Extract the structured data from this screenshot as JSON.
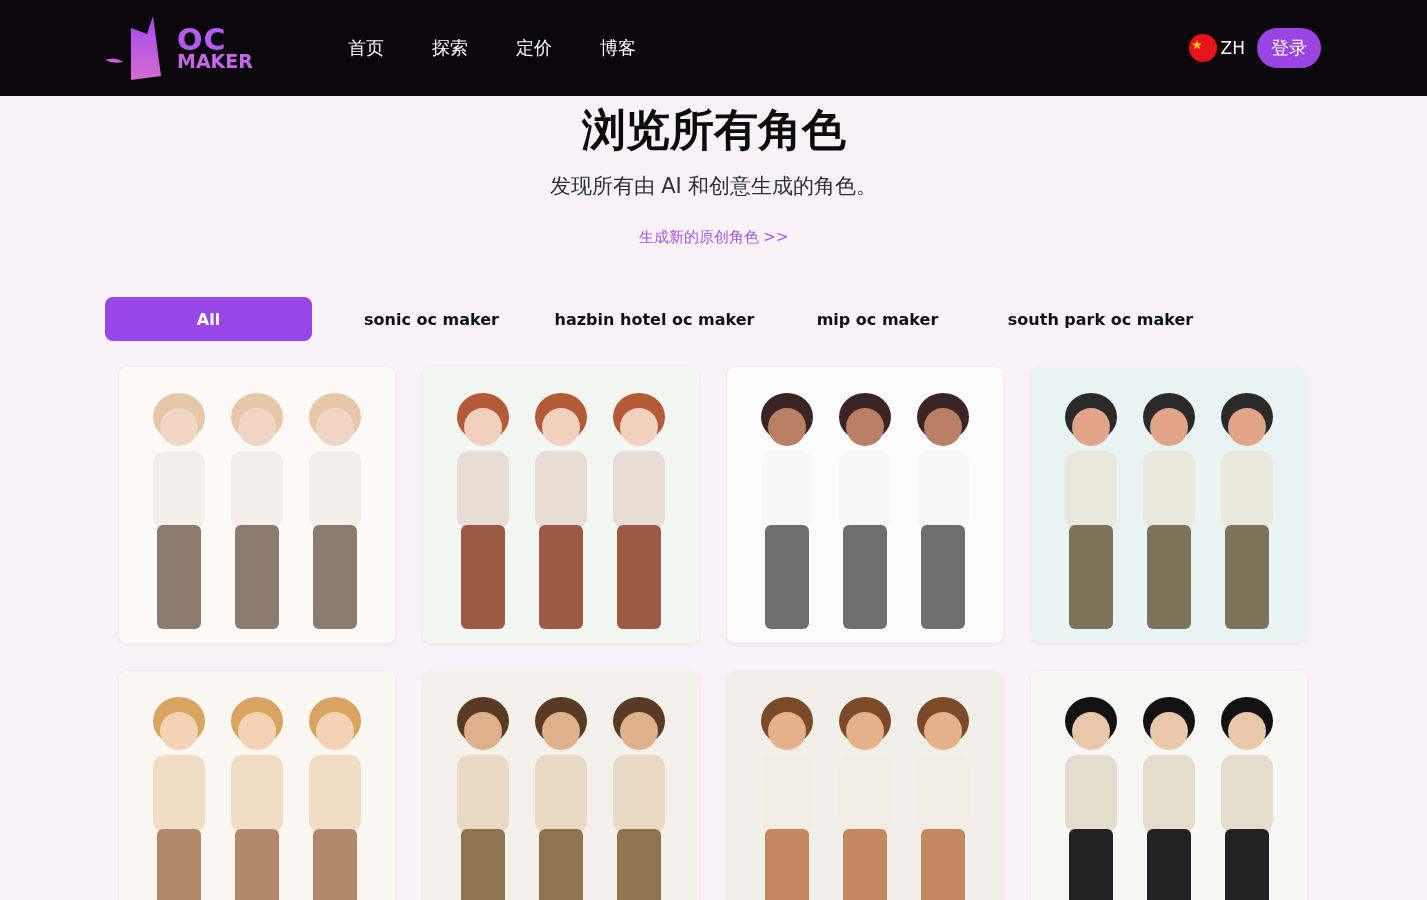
{
  "header": {
    "logo": {
      "line1": "OC",
      "line2": "MAKER"
    },
    "nav": [
      {
        "label": "首页"
      },
      {
        "label": "探索"
      },
      {
        "label": "定价"
      },
      {
        "label": "博客"
      }
    ],
    "language": {
      "code": "ZH"
    },
    "login_button": "登录"
  },
  "hero": {
    "title": "浏览所有角色",
    "subtitle": "发现所有由 AI 和创意生成的角色。",
    "link": "生成新的原创角色 >>"
  },
  "filters": [
    {
      "label": "All",
      "selected": true
    },
    {
      "label": "sonic oc maker",
      "selected": false
    },
    {
      "label": "hazbin hotel oc maker",
      "selected": false
    },
    {
      "label": "mip oc maker",
      "selected": false
    },
    {
      "label": "south park oc maker",
      "selected": false
    }
  ]
}
